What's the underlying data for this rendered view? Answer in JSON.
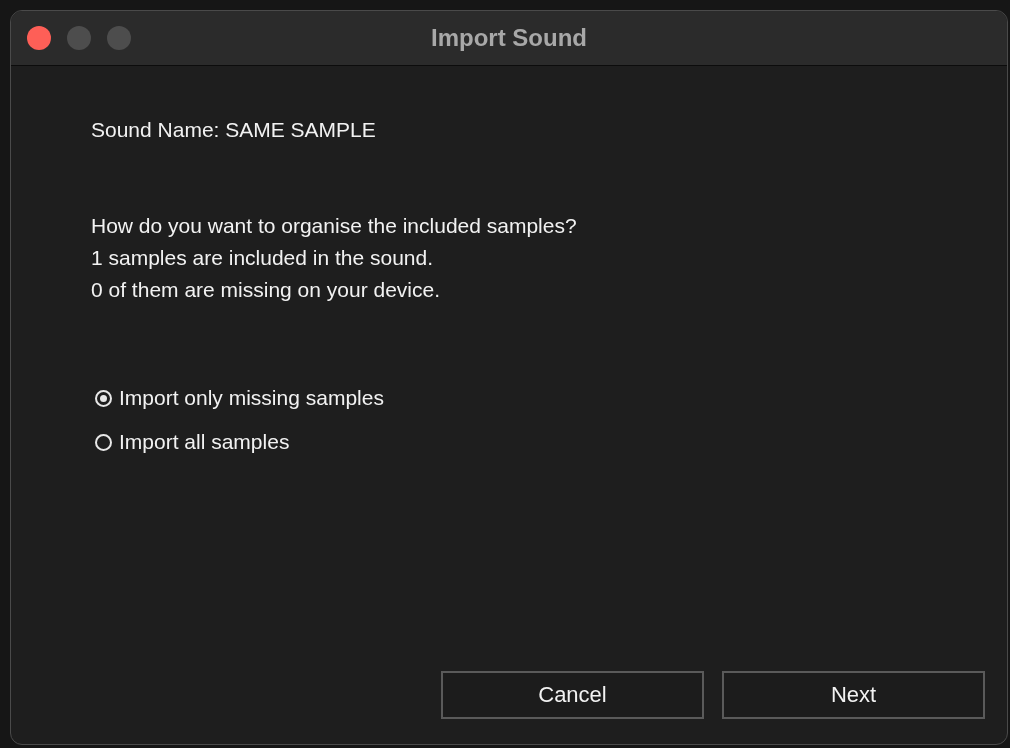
{
  "window": {
    "title": "Import Sound"
  },
  "sound_name": "Sound Name: SAME SAMPLE",
  "message_lines": [
    "How do you want to organise the included samples?",
    "1 samples are included in the sound.",
    "0 of them are missing on your device."
  ],
  "options": [
    {
      "label": "Import only missing samples",
      "selected": true
    },
    {
      "label": "Import all samples",
      "selected": false
    }
  ],
  "buttons": [
    "Cancel",
    "Next"
  ]
}
